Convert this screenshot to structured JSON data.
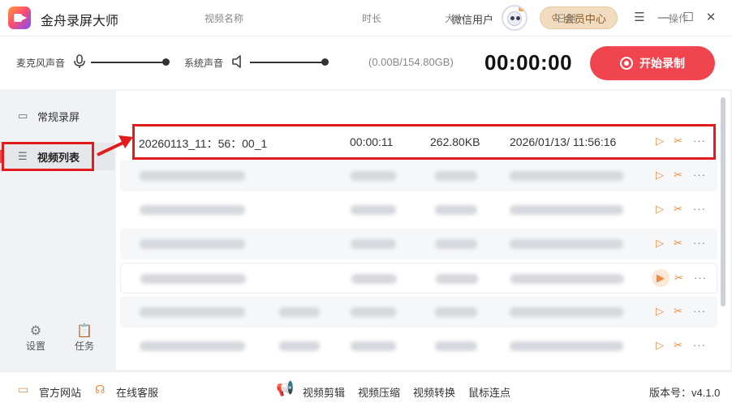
{
  "app": {
    "title": "金舟录屏大师",
    "user_name": "微信用户",
    "vip_button": "会员中心",
    "window_controls": [
      "menu-icon",
      "minimize-icon",
      "maximize-icon",
      "close-icon"
    ]
  },
  "toolbar": {
    "mic_label": "麦克风声音",
    "mic_volume_percent": 100,
    "system_label": "系统声音",
    "system_volume_percent": 100,
    "storage": "(0.00B/154.80GB)",
    "timer": "00:00:00",
    "record_button": "开始录制"
  },
  "sidebar": {
    "items": [
      {
        "label": "常规录屏",
        "icon": "video-camera-icon"
      },
      {
        "label": "视频列表",
        "icon": "list-icon",
        "active": true
      }
    ],
    "footer": [
      {
        "label": "设置",
        "icon": "gear-icon"
      },
      {
        "label": "任务",
        "icon": "task-icon"
      }
    ]
  },
  "table": {
    "headers": [
      "视频名称",
      "时长",
      "大小",
      "日期",
      "操作"
    ],
    "rows": [
      {
        "name": "20260113_11：56：00_1",
        "duration": "00:00:11",
        "size": "262.80KB",
        "date": "2026/01/13/ 11:56:16"
      }
    ],
    "blurred_row_count": 6
  },
  "statusbar": {
    "left": [
      "官方网站",
      "在线客服"
    ],
    "tools": [
      "视频剪辑",
      "视频压缩",
      "视频转换",
      "鼠标连点"
    ],
    "version": "版本号：v4.1.0"
  },
  "colors": {
    "accent": "#f0454e",
    "action_orange": "#f08a3c",
    "highlight_box": "#e01c1c"
  }
}
